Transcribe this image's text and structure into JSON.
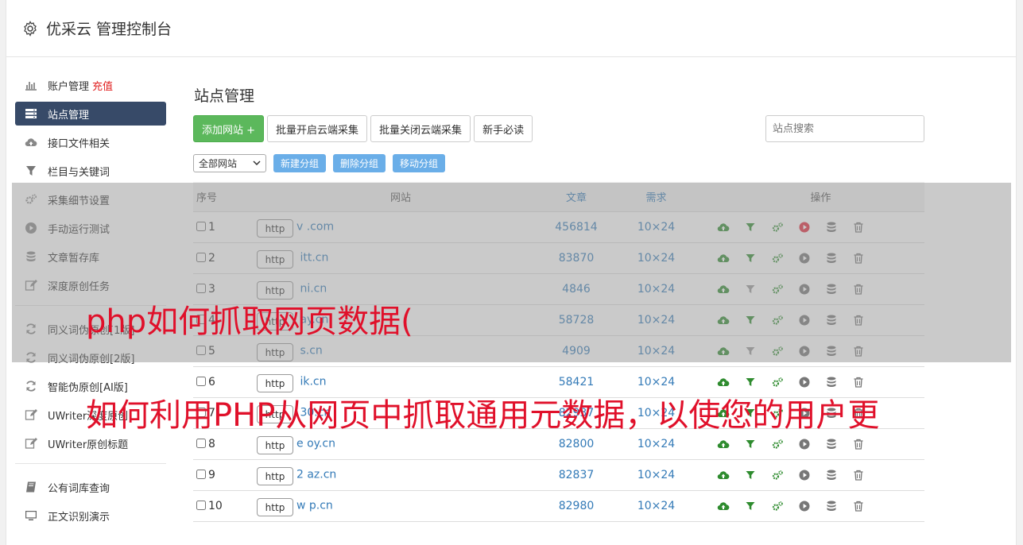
{
  "app": {
    "title": "优采云 管理控制台"
  },
  "sidebar": {
    "items": [
      {
        "label": "账户管理",
        "extra": "充值",
        "icon": "bar-chart-icon"
      },
      {
        "label": "站点管理",
        "icon": "server-list-icon",
        "active": true
      },
      {
        "label": "接口文件相关",
        "icon": "cloud-upload-icon"
      },
      {
        "label": "栏目与关键词",
        "icon": "filter-icon"
      },
      {
        "label": "采集细节设置",
        "icon": "cogs-icon"
      },
      {
        "label": "手动运行测试",
        "icon": "play-circle-icon"
      },
      {
        "label": "文章暂存库",
        "icon": "database-icon"
      },
      {
        "label": "深度原创任务",
        "icon": "edit-icon"
      },
      {
        "label": "同义词伪原创[1版]",
        "icon": "refresh-icon"
      },
      {
        "label": "同义词伪原创[2版]",
        "icon": "refresh-icon"
      },
      {
        "label": "智能伪原创[AI版]",
        "icon": "refresh-icon"
      },
      {
        "label": "UWriter深度原创",
        "icon": "edit-icon"
      },
      {
        "label": "UWriter原创标题",
        "icon": "edit-icon"
      },
      {
        "label": "公有词库查询",
        "icon": "book-icon"
      },
      {
        "label": "正文识别演示",
        "icon": "monitor-icon"
      }
    ]
  },
  "main": {
    "title": "站点管理",
    "toolbar": {
      "add_site": "添加网站 +",
      "batch_open": "批量开启云端采集",
      "batch_close": "批量关闭云端采集",
      "newbie": "新手必读",
      "search_placeholder": "站点搜索"
    },
    "filters": {
      "group_select": "全部网站",
      "new_group": "新建分组",
      "delete_group": "删除分组",
      "move_group": "移动分组"
    },
    "table": {
      "headers": {
        "no": "序号",
        "site": "网站",
        "articles": "文章",
        "demand": "需求",
        "ops": "操作"
      },
      "http_label": "http",
      "rows": [
        {
          "no": "1",
          "site": "v            .com",
          "articles": "456814",
          "demand": "10×24",
          "play_red": true,
          "filter_grey": false
        },
        {
          "no": "2",
          "site": "     itt.cn",
          "articles": "83870",
          "demand": "10×24",
          "play_red": false,
          "filter_grey": false
        },
        {
          "no": "3",
          "site": "     ni.cn",
          "articles": "4846",
          "demand": "10×24",
          "play_red": false,
          "filter_grey": true
        },
        {
          "no": "4",
          "site": "      ay.cn",
          "articles": "58728",
          "demand": "10×24",
          "play_red": false,
          "filter_grey": false
        },
        {
          "no": "5",
          "site": "      s.cn",
          "articles": "4909",
          "demand": "10×24",
          "play_red": false,
          "filter_grey": true
        },
        {
          "no": "6",
          "site": "     ik.cn",
          "articles": "58421",
          "demand": "10×24",
          "play_red": false,
          "filter_grey": false
        },
        {
          "no": "7",
          "site": "     30.cn",
          "articles": "82937",
          "demand": "10×24",
          "play_red": false,
          "filter_grey": false
        },
        {
          "no": "8",
          "site": "e    oy.cn",
          "articles": "82800",
          "demand": "10×24",
          "play_red": false,
          "filter_grey": false
        },
        {
          "no": "9",
          "site": "2     az.cn",
          "articles": "82837",
          "demand": "10×24",
          "play_red": false,
          "filter_grey": false
        },
        {
          "no": "10",
          "site": "w     p.cn",
          "articles": "82980",
          "demand": "10×24",
          "play_red": false,
          "filter_grey": false
        }
      ]
    }
  },
  "overlay": {
    "caption_1": "php如何抓取网页数据(",
    "caption_2": "如何利用PHP从网页中抓取通用元数据，以使您的用户更"
  },
  "colors": {
    "sidebar_active": "#374a68",
    "accent_green": "#5cb85c",
    "small_button_blue": "#6aaee8",
    "link_blue": "#337ab7",
    "op_green": "#2e8b2e",
    "caption_red": "#e0102a"
  }
}
